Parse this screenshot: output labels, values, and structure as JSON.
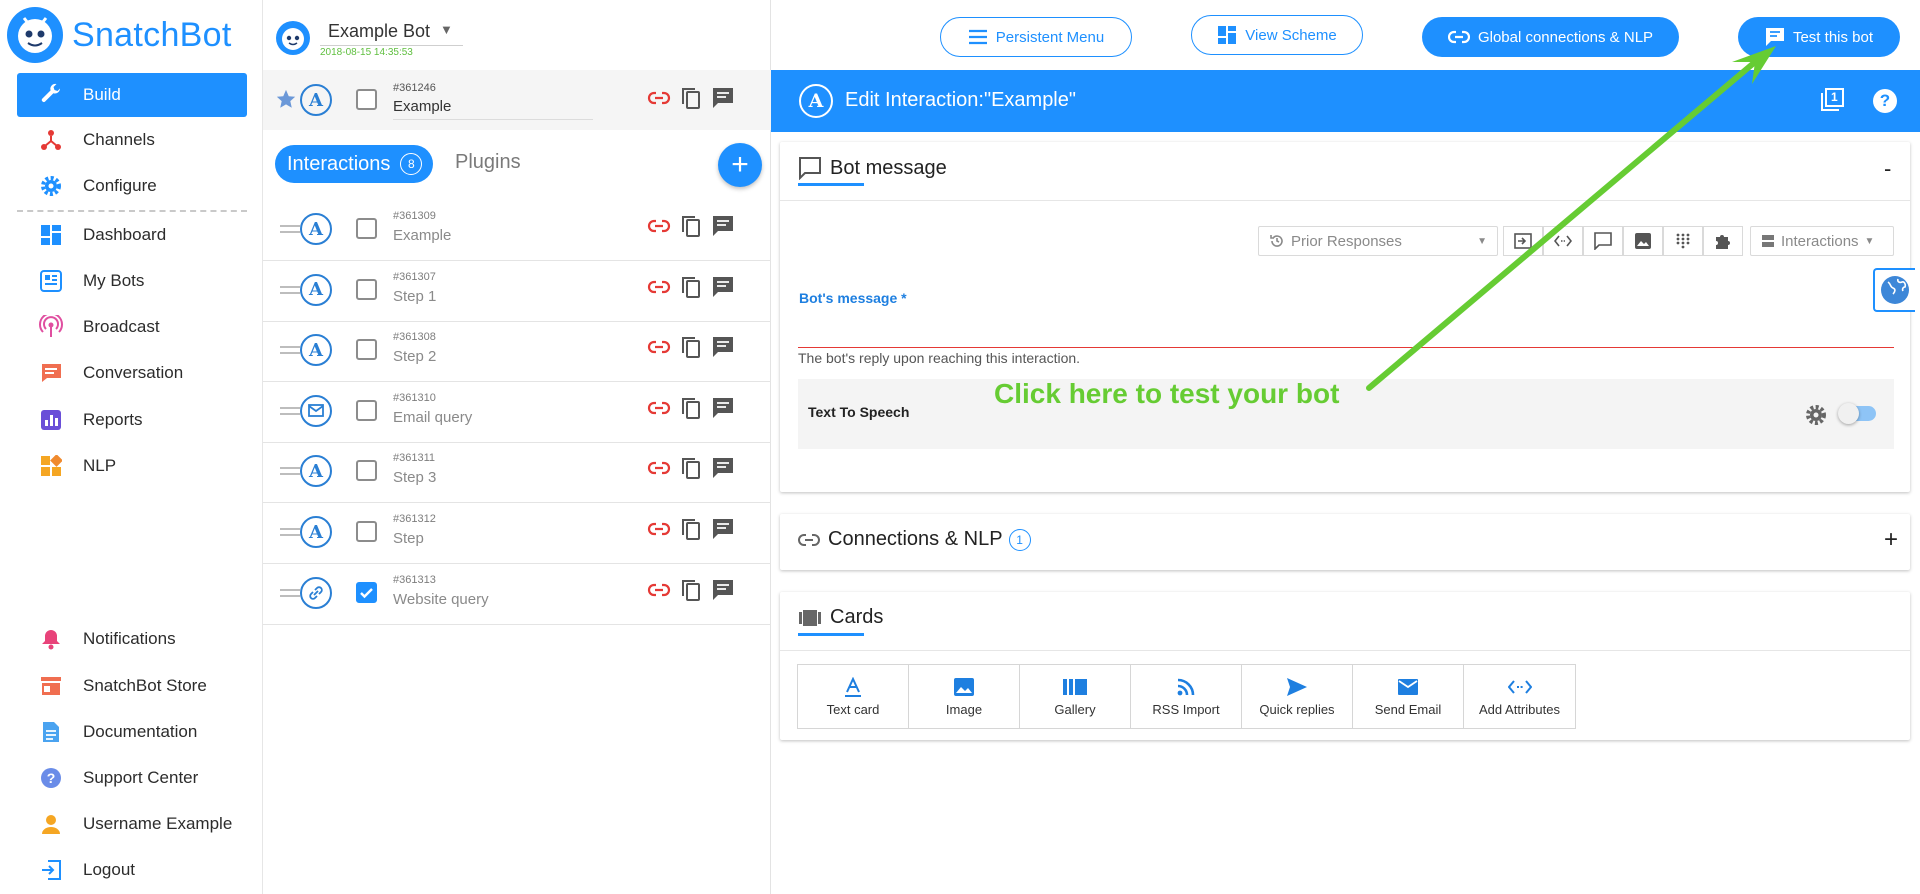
{
  "brand": {
    "name": "SnatchBot"
  },
  "sidebar": {
    "top_items": [
      {
        "label": "Build",
        "icon": "wrench-icon"
      },
      {
        "label": "Channels",
        "icon": "channels-icon"
      },
      {
        "label": "Configure",
        "icon": "gear-icon"
      }
    ],
    "main_items": [
      {
        "label": "Dashboard",
        "icon": "dashboard-icon"
      },
      {
        "label": "My Bots",
        "icon": "bots-icon"
      },
      {
        "label": "Broadcast",
        "icon": "broadcast-icon"
      },
      {
        "label": "Conversation",
        "icon": "conversation-icon"
      },
      {
        "label": "Reports",
        "icon": "reports-icon"
      },
      {
        "label": "NLP",
        "icon": "nlp-icon"
      }
    ],
    "bottom_items": [
      {
        "label": "Notifications",
        "icon": "bell-icon"
      },
      {
        "label": "SnatchBot Store",
        "icon": "store-icon"
      },
      {
        "label": "Documentation",
        "icon": "document-icon"
      },
      {
        "label": "Support Center",
        "icon": "help-icon"
      },
      {
        "label": "Username Example",
        "icon": "user-icon"
      },
      {
        "label": "Logout",
        "icon": "logout-icon"
      }
    ]
  },
  "bot": {
    "name": "Example Bot",
    "timestamp": "2018-08-15 14:35:53"
  },
  "pinned": {
    "id": "#361246",
    "name": "Example"
  },
  "tabs": {
    "interactions_label": "Interactions",
    "interactions_count": "8",
    "plugins_label": "Plugins",
    "add_symbol": "+"
  },
  "interactions": [
    {
      "id": "#361309",
      "name": "Example",
      "type": "text",
      "checked": false
    },
    {
      "id": "#361307",
      "name": "Step 1",
      "type": "text",
      "checked": false
    },
    {
      "id": "#361308",
      "name": "Step 2",
      "type": "text",
      "checked": false
    },
    {
      "id": "#361310",
      "name": "Email query",
      "type": "email",
      "checked": false
    },
    {
      "id": "#361311",
      "name": "Step 3",
      "type": "text",
      "checked": false
    },
    {
      "id": "#361312",
      "name": "Step",
      "type": "text",
      "checked": false
    },
    {
      "id": "#361313",
      "name": "Website query",
      "type": "link",
      "checked": true
    }
  ],
  "header": {
    "persistent_menu": "Persistent Menu",
    "view_scheme": "View Scheme",
    "global_connections": "Global connections & NLP",
    "test_bot": "Test this bot"
  },
  "edit": {
    "title": "Edit Interaction:\"Example\"",
    "type_letter": "A",
    "help_symbol": "?",
    "layers_symbol": "1"
  },
  "bot_message": {
    "title": "Bot message",
    "collapse_symbol": "-",
    "prior_responses": "Prior Responses",
    "interactions_select": "Interactions",
    "field_label": "Bot's message *",
    "field_hint": "The bot's reply upon reaching this interaction.",
    "tts_label": "Text To Speech"
  },
  "annotation": {
    "text": "Click here to test your bot",
    "color": "#66cc33"
  },
  "connections": {
    "title": "Connections & NLP",
    "count": "1",
    "expand_symbol": "+"
  },
  "cards": {
    "title": "Cards",
    "items": [
      {
        "label": "Text card",
        "icon": "text-card-icon"
      },
      {
        "label": "Image",
        "icon": "image-icon"
      },
      {
        "label": "Gallery",
        "icon": "gallery-icon"
      },
      {
        "label": "RSS Import",
        "icon": "rss-icon"
      },
      {
        "label": "Quick replies",
        "icon": "send-icon"
      },
      {
        "label": "Send Email",
        "icon": "email-icon"
      },
      {
        "label": "Add Attributes",
        "icon": "attributes-icon"
      }
    ]
  },
  "colors": {
    "accent": "#1e90ff",
    "link_red": "#e53935",
    "annotation_green": "#66cc33"
  }
}
